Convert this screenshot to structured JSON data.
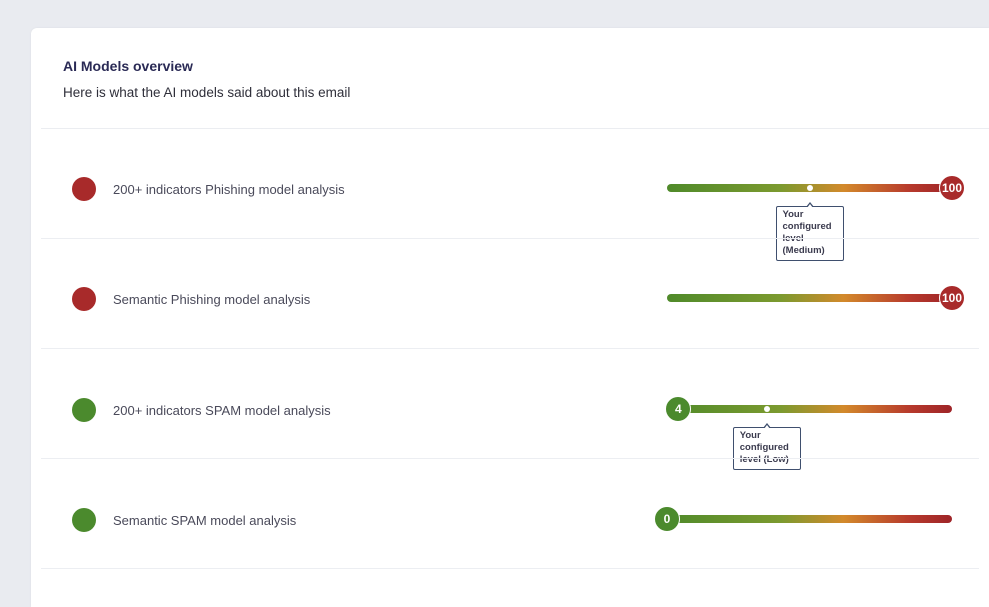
{
  "panel": {
    "title": "AI Models overview",
    "subtitle": "Here is what the AI models said about this email"
  },
  "colors": {
    "danger": "#a82a2a",
    "safe": "#4b8a2d"
  },
  "models": [
    {
      "label": "200+ indicators Phishing model analysis",
      "status": "danger",
      "score": "100",
      "score_value": 100,
      "configured_level_value": 50,
      "tooltip": "Your\nconfigured\nlevel\n(Medium)"
    },
    {
      "label": "Semantic Phishing model analysis",
      "status": "danger",
      "score": "100",
      "score_value": 100
    },
    {
      "label": "200+ indicators SPAM model analysis",
      "status": "safe",
      "score": "4",
      "score_value": 4,
      "configured_level_value": 35,
      "tooltip": "Your\nconfigured\nlevel (Low)"
    },
    {
      "label": "Semantic SPAM model analysis",
      "status": "safe",
      "score": "0",
      "score_value": 0
    }
  ]
}
